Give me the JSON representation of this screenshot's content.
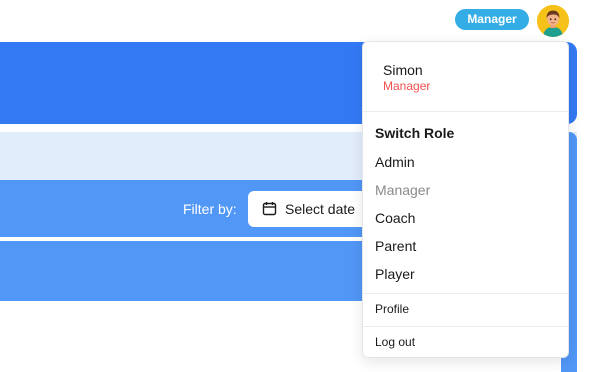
{
  "header": {
    "role_badge": "Manager",
    "avatar_icon": "user-avatar-icon"
  },
  "filter": {
    "label": "Filter by:",
    "date_button": "Select date",
    "date_icon": "calendar-icon"
  },
  "menu": {
    "user_name": "Simon",
    "user_role": "Manager",
    "switch_role_title": "Switch Role",
    "roles": [
      "Admin",
      "Manager",
      "Coach",
      "Parent",
      "Player"
    ],
    "current_role": "Manager",
    "profile": "Profile",
    "logout": "Log out"
  },
  "colors": {
    "primary_blue": "#3479f4",
    "secondary_blue": "#5197f6",
    "light_blue": "#e2edfc",
    "badge_blue": "#34ade6",
    "role_red": "#ef5350"
  }
}
